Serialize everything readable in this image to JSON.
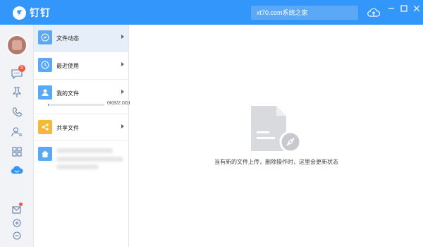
{
  "app": {
    "name": "钉钉"
  },
  "search": {
    "text": "xt70.com系统之家"
  },
  "rail": {
    "chat_badge": "5"
  },
  "files": {
    "items": [
      {
        "label": "文件动态"
      },
      {
        "label": "最近使用"
      },
      {
        "label": "我的文件",
        "storage": "0KB/2.0GB",
        "usage_fraction": 0
      },
      {
        "label": "共享文件"
      }
    ]
  },
  "main": {
    "empty_message": "当有新的文件上传，删除操作时，这里会更新状态"
  },
  "colors": {
    "brand": "#3296fa",
    "badge": "#f25643",
    "folder_share": "#f5b83d",
    "icon_blue": "#5ba9f6"
  }
}
